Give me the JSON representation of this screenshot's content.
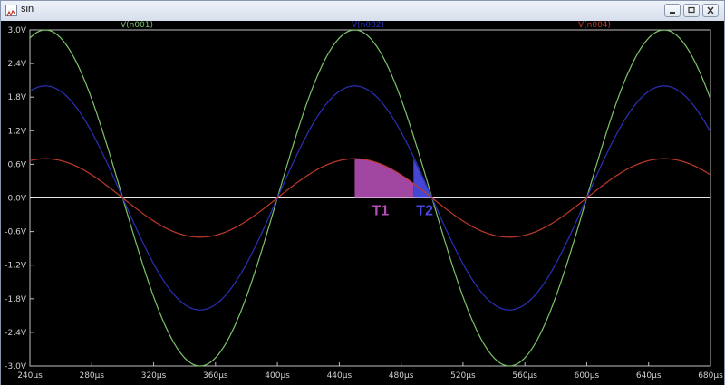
{
  "window": {
    "title": "sin",
    "controls": [
      "minimize",
      "maximize",
      "close"
    ]
  },
  "chart_data": {
    "type": "line",
    "x_ticks": [
      "240µs",
      "280µs",
      "320µs",
      "360µs",
      "400µs",
      "440µs",
      "480µs",
      "520µs",
      "560µs",
      "600µs",
      "640µs",
      "680µs"
    ],
    "x_tick_values_us": [
      240,
      280,
      320,
      360,
      400,
      440,
      480,
      520,
      560,
      600,
      640,
      680
    ],
    "y_ticks": [
      "3.0V",
      "2.4V",
      "1.8V",
      "1.2V",
      "0.6V",
      "0.0V",
      "-0.6V",
      "-1.2V",
      "-1.8V",
      "-2.4V",
      "-3.0V"
    ],
    "y_tick_values": [
      3.0,
      2.4,
      1.8,
      1.2,
      0.6,
      0.0,
      -0.6,
      -1.2,
      -1.8,
      -2.4,
      -3.0
    ],
    "xlim_us": [
      240,
      680
    ],
    "ylim": [
      -3.0,
      3.0
    ],
    "period_us": 200,
    "series": [
      {
        "name": "V(n001)",
        "amplitude": 3.0,
        "color": "#7cc46a",
        "peak_x_us": [
          250,
          450,
          650
        ],
        "zero_cross_us": [
          300,
          400,
          500,
          600
        ]
      },
      {
        "name": "V(n002)",
        "amplitude": 2.0,
        "color": "#2b2fb8",
        "peak_x_us": [
          250,
          450,
          650
        ],
        "zero_cross_us": [
          300,
          400,
          500,
          600
        ]
      },
      {
        "name": "V(n004)",
        "amplitude": 0.7,
        "color": "#c0392b",
        "peak_x_us": [
          250,
          450,
          650
        ],
        "zero_cross_us": [
          300,
          400,
          500,
          600
        ]
      }
    ],
    "annotations": [
      {
        "label": "T1",
        "color": "#b34fb3",
        "from_us": 450,
        "to_us": 488,
        "region": "under V(n004)"
      },
      {
        "label": "T2",
        "color": "#4a4ae0",
        "from_us": 488,
        "to_us": 500,
        "region": "triangle to zero crossing"
      }
    ],
    "grid": false
  }
}
